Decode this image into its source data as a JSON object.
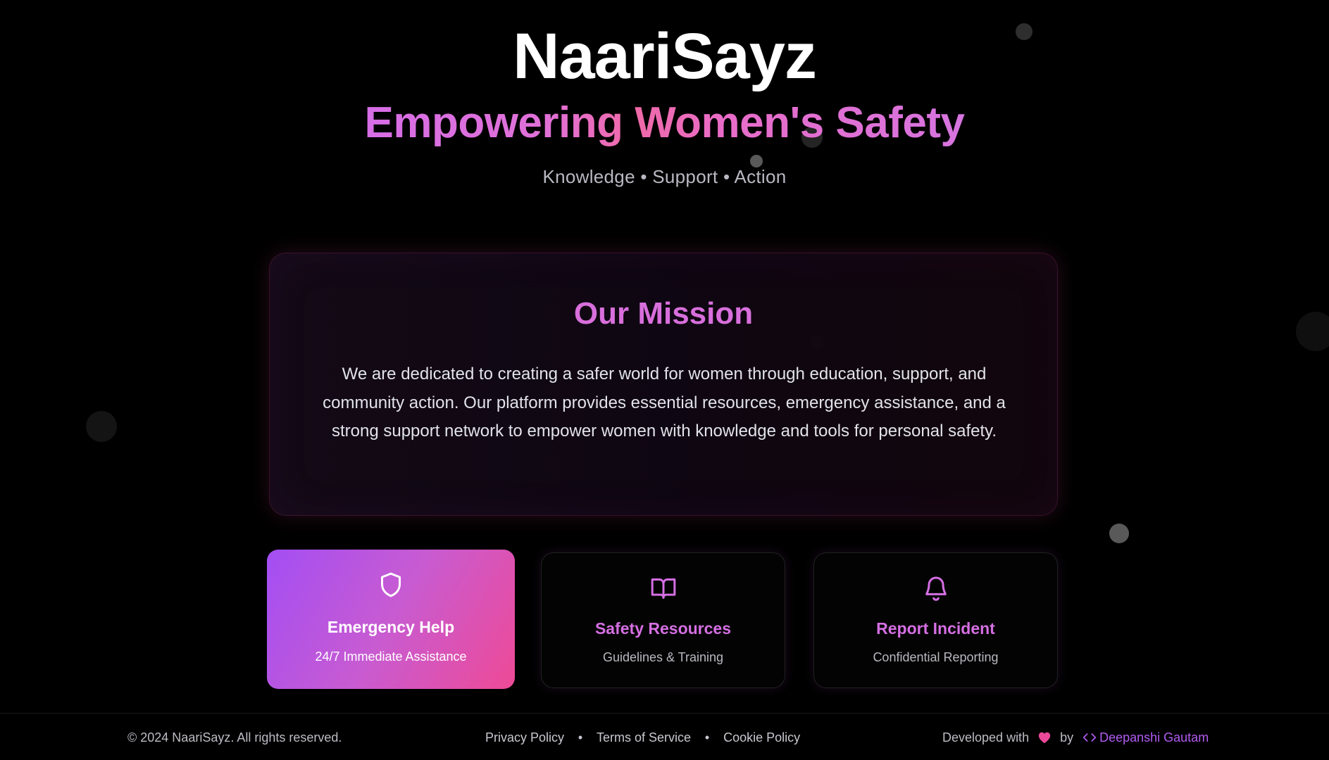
{
  "header": {
    "brand": "NaariSayz",
    "tagline": "Empowering Women's Safety",
    "subline": "Knowledge • Support • Action"
  },
  "mission": {
    "title": "Our Mission",
    "text": "We are dedicated to creating a safer world for women through education, support, and community action. Our platform provides essential resources, emergency assistance, and a strong support network to empower women with knowledge and tools for personal safety."
  },
  "cards": [
    {
      "title": "Emergency Help",
      "subtitle": "24/7 Immediate Assistance",
      "icon": "shield-icon",
      "active": true
    },
    {
      "title": "Safety Resources",
      "subtitle": "Guidelines & Training",
      "icon": "book-icon",
      "active": false
    },
    {
      "title": "Report Incident",
      "subtitle": "Confidential Reporting",
      "icon": "bell-icon",
      "active": false
    }
  ],
  "footer": {
    "copyright": "© 2024 NaariSayz. All rights reserved.",
    "links": [
      "Privacy Policy",
      "Terms of Service",
      "Cookie Policy"
    ],
    "separator": "•",
    "developed_with": "Developed with",
    "by": "by",
    "author": "Deepanshi Gautam",
    "icons": [
      "heart-icon",
      "code-icon"
    ]
  },
  "colors": {
    "background": "#000000",
    "accent_purple": "#d56fe3",
    "accent_pink": "#ee4a96",
    "author_link": "#b15cf2",
    "heart": "#ec4899"
  }
}
